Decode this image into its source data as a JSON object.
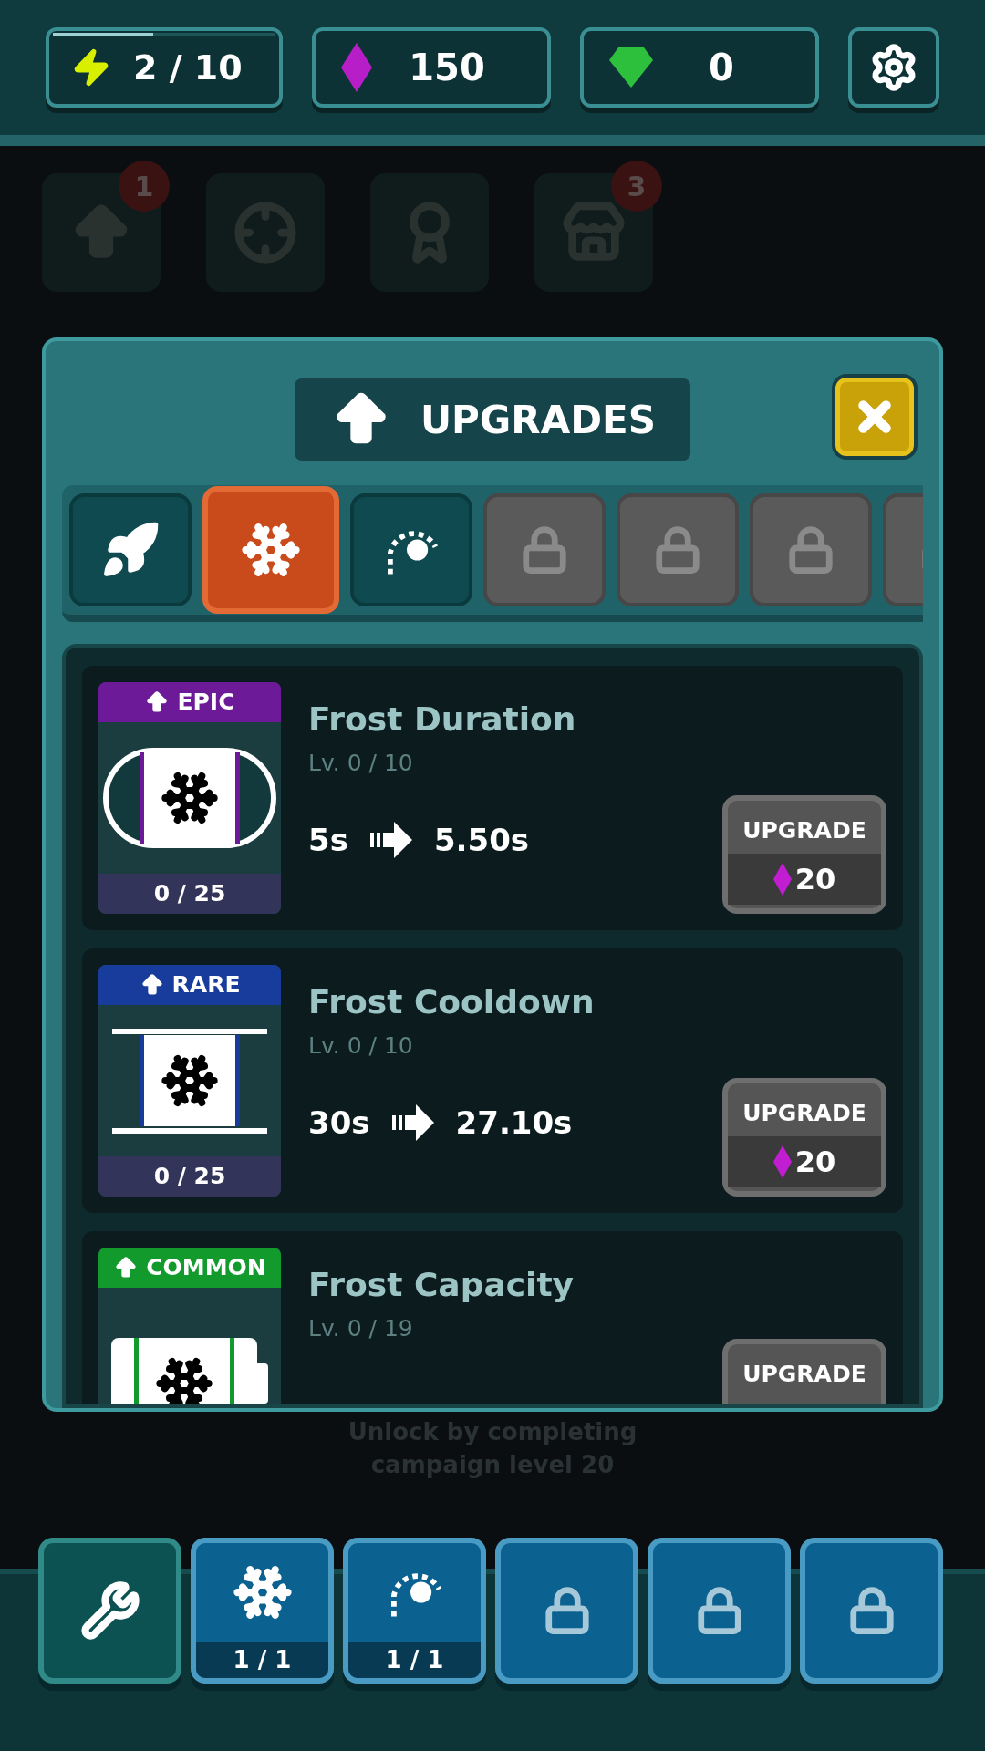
{
  "top_bar": {
    "energy": {
      "value": "2 / 10",
      "level": 0.45
    },
    "diamonds": {
      "value": "150"
    },
    "gems": {
      "value": "0"
    }
  },
  "background_nav": [
    {
      "kind": "upgrade",
      "badge": "1"
    },
    {
      "kind": "target"
    },
    {
      "kind": "award"
    },
    {
      "kind": "shop",
      "badge": "3"
    }
  ],
  "modal": {
    "title": "UPGRADES",
    "tabs": [
      {
        "kind": "rocket",
        "selected": false
      },
      {
        "kind": "snowflake",
        "selected": true
      },
      {
        "kind": "orbit",
        "selected": false
      },
      {
        "kind": "locked",
        "selected": false
      },
      {
        "kind": "locked",
        "selected": false
      },
      {
        "kind": "locked",
        "selected": false
      },
      {
        "kind": "locked",
        "selected": false
      }
    ],
    "upgrades": [
      {
        "rarity": "EPIC",
        "color": "#6c1a98",
        "kind": "dial",
        "count": "0 / 25",
        "name": "Frost Duration",
        "level_text": "Lv. 0 / 10",
        "from": "5s",
        "to": "5.50s",
        "button": "UPGRADE",
        "cost": "20"
      },
      {
        "rarity": "RARE",
        "color": "#183c9c",
        "kind": "hourglass",
        "count": "0 / 25",
        "name": "Frost Cooldown",
        "level_text": "Lv. 0 / 10",
        "from": "30s",
        "to": "27.10s",
        "button": "UPGRADE",
        "cost": "20"
      },
      {
        "rarity": "COMMON",
        "color": "#129a2c",
        "kind": "battery",
        "name": "Frost Capacity",
        "level_text": "Lv. 0 / 19",
        "button": "UPGRADE"
      }
    ]
  },
  "background_note": "Unlock by completing campaign level 20",
  "bottom_bar": [
    {
      "kind": "tools",
      "selected": true
    },
    {
      "kind": "snowflake",
      "selected": false,
      "count": "1 / 1"
    },
    {
      "kind": "orbit",
      "selected": false,
      "count": "1 / 1"
    },
    {
      "kind": "locked",
      "selected": false
    },
    {
      "kind": "locked",
      "selected": false
    },
    {
      "kind": "locked",
      "selected": false
    }
  ]
}
